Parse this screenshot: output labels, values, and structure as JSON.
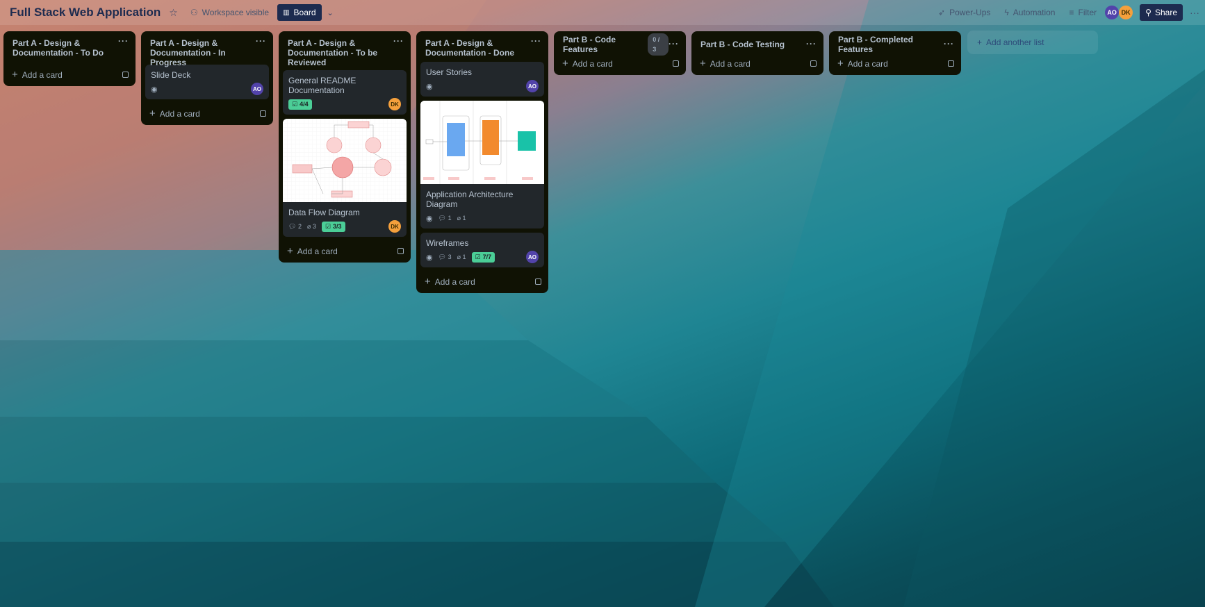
{
  "topbar": {
    "title": "Full Stack Web Application",
    "visibility": "Workspace visible",
    "view": "Board",
    "power_ups": "Power-Ups",
    "automation": "Automation",
    "filter": "Filter",
    "share": "Share",
    "members": [
      "AO",
      "DK"
    ]
  },
  "lists": [
    {
      "title": "Part A - Design & Documentation - To Do",
      "add_card": "Add a card",
      "cards": []
    },
    {
      "title": "Part A - Design & Documentation - In Progress",
      "add_card": "Add a card",
      "cards": [
        {
          "title": "Slide Deck",
          "member": "AO"
        }
      ]
    },
    {
      "title": "Part A - Design & Documentation - To be Reviewed",
      "add_card": "Add a card",
      "cards": [
        {
          "title": "General README Documentation",
          "checklist": "4/4",
          "member": "DK"
        },
        {
          "title": "Data Flow Diagram",
          "comments": "2",
          "attachments": "3",
          "checklist": "3/3",
          "member": "DK"
        }
      ]
    },
    {
      "title": "Part A - Design & Documentation - Done",
      "add_card": "Add a card",
      "cards": [
        {
          "title": "User Stories",
          "member": "AO"
        },
        {
          "title": "Application Architecture Diagram",
          "comments": "1",
          "attachments": "1"
        },
        {
          "title": "Wireframes",
          "comments": "3",
          "attachments": "1",
          "checklist": "7/7",
          "member": "AO"
        }
      ]
    },
    {
      "title": "Part B - Code Features",
      "count": "0 / 3",
      "add_card": "Add a card",
      "cards": []
    },
    {
      "title": "Part B - Code Testing",
      "add_card": "Add a card",
      "cards": []
    },
    {
      "title": "Part B - Completed Features",
      "add_card": "Add a card",
      "cards": []
    }
  ],
  "add_list": "Add another list"
}
